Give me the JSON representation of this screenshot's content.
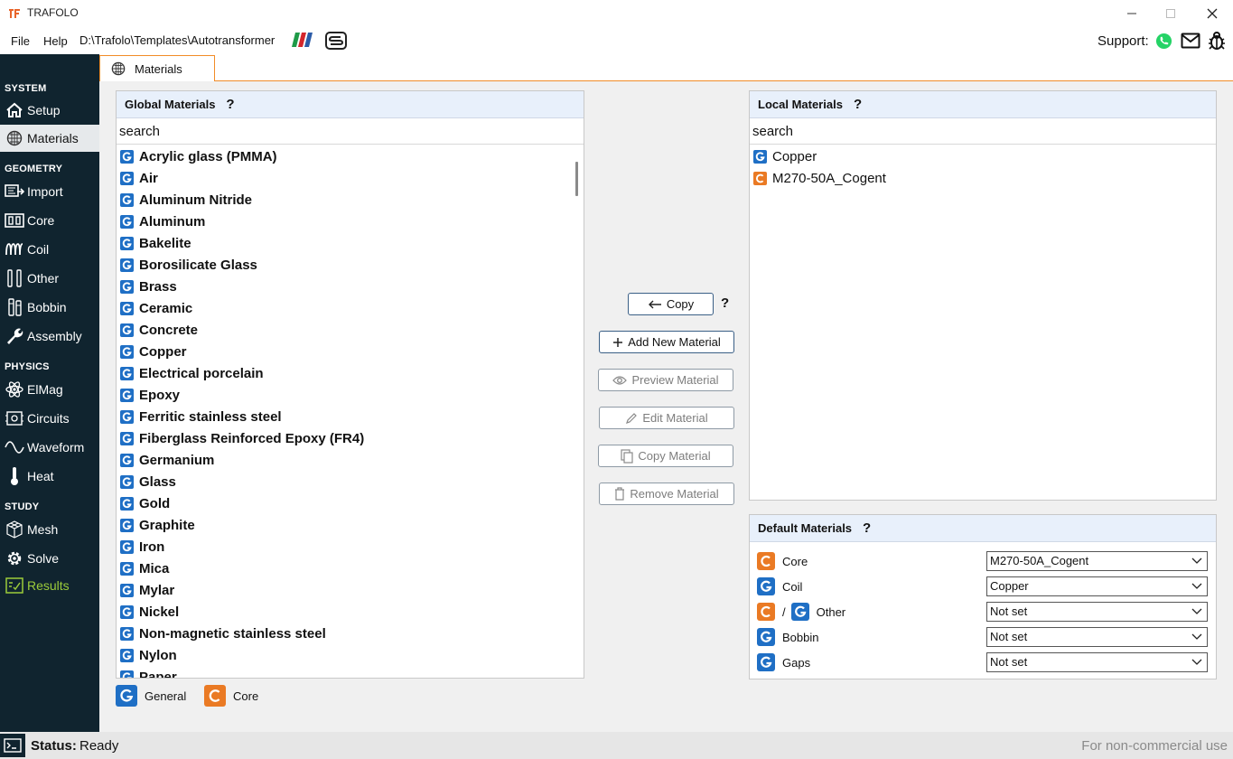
{
  "window": {
    "title": "TRAFOLO",
    "minimize": "—",
    "maximize": "☐",
    "close": "✕"
  },
  "menu": {
    "file": "File",
    "help": "Help",
    "path": "D:\\Trafolo\\Templates\\Autotransformer",
    "support": "Support:"
  },
  "sidebar": {
    "system": "SYSTEM",
    "geometry": "GEOMETRY",
    "physics": "PHYSICS",
    "study": "STUDY",
    "items": {
      "setup": "Setup",
      "materials": "Materials",
      "import": "Import",
      "core": "Core",
      "coil": "Coil",
      "other": "Other",
      "bobbin": "Bobbin",
      "assembly": "Assembly",
      "elmag": "ElMag",
      "circuits": "Circuits",
      "waveform": "Waveform",
      "heat": "Heat",
      "mesh": "Mesh",
      "solve": "Solve",
      "results": "Results"
    }
  },
  "tab": {
    "label": "Materials"
  },
  "global": {
    "title": "Global Materials",
    "help": "?",
    "search": "search",
    "items": [
      "Acrylic glass (PMMA)",
      "Air",
      "Aluminum Nitride",
      "Aluminum",
      "Bakelite",
      "Borosilicate Glass",
      "Brass",
      "Ceramic",
      "Concrete",
      "Copper",
      "Electrical porcelain",
      "Epoxy",
      "Ferritic stainless steel",
      "Fiberglass Reinforced Epoxy (FR4)",
      "Germanium",
      "Glass",
      "Gold",
      "Graphite",
      "Iron",
      "Mica",
      "Mylar",
      "Nickel",
      "Non-magnetic stainless steel",
      "Nylon",
      "Paper"
    ]
  },
  "local": {
    "title": "Local Materials",
    "help": "?",
    "search": "search",
    "items": [
      {
        "name": "Copper",
        "kind": "G"
      },
      {
        "name": "M270-50A_Cogent",
        "kind": "C"
      }
    ]
  },
  "actions": {
    "copy": "Copy",
    "copy_help": "?",
    "add": "Add New Material",
    "preview": "Preview Material",
    "edit": "Edit Material",
    "copy_material": "Copy Material",
    "remove": "Remove Material"
  },
  "defaults": {
    "title": "Default Materials",
    "help": "?",
    "slash": "/",
    "rows": {
      "core": {
        "label": "Core",
        "value": "M270-50A_Cogent"
      },
      "coil": {
        "label": "Coil",
        "value": "Copper"
      },
      "other": {
        "label": "Other",
        "value": "Not set"
      },
      "bobbin": {
        "label": "Bobbin",
        "value": "Not set"
      },
      "gaps": {
        "label": "Gaps",
        "value": "Not set"
      }
    }
  },
  "legend": {
    "general": "General",
    "core": "Core"
  },
  "status": {
    "label": "Status:",
    "value": "Ready",
    "license": "For non-commercial use"
  },
  "colors": {
    "sidebar": "#10242f",
    "accent": "#f28c28",
    "general_badge": "#1f6fc5",
    "core_badge": "#ea7a24",
    "results": "#9ccc3a"
  }
}
